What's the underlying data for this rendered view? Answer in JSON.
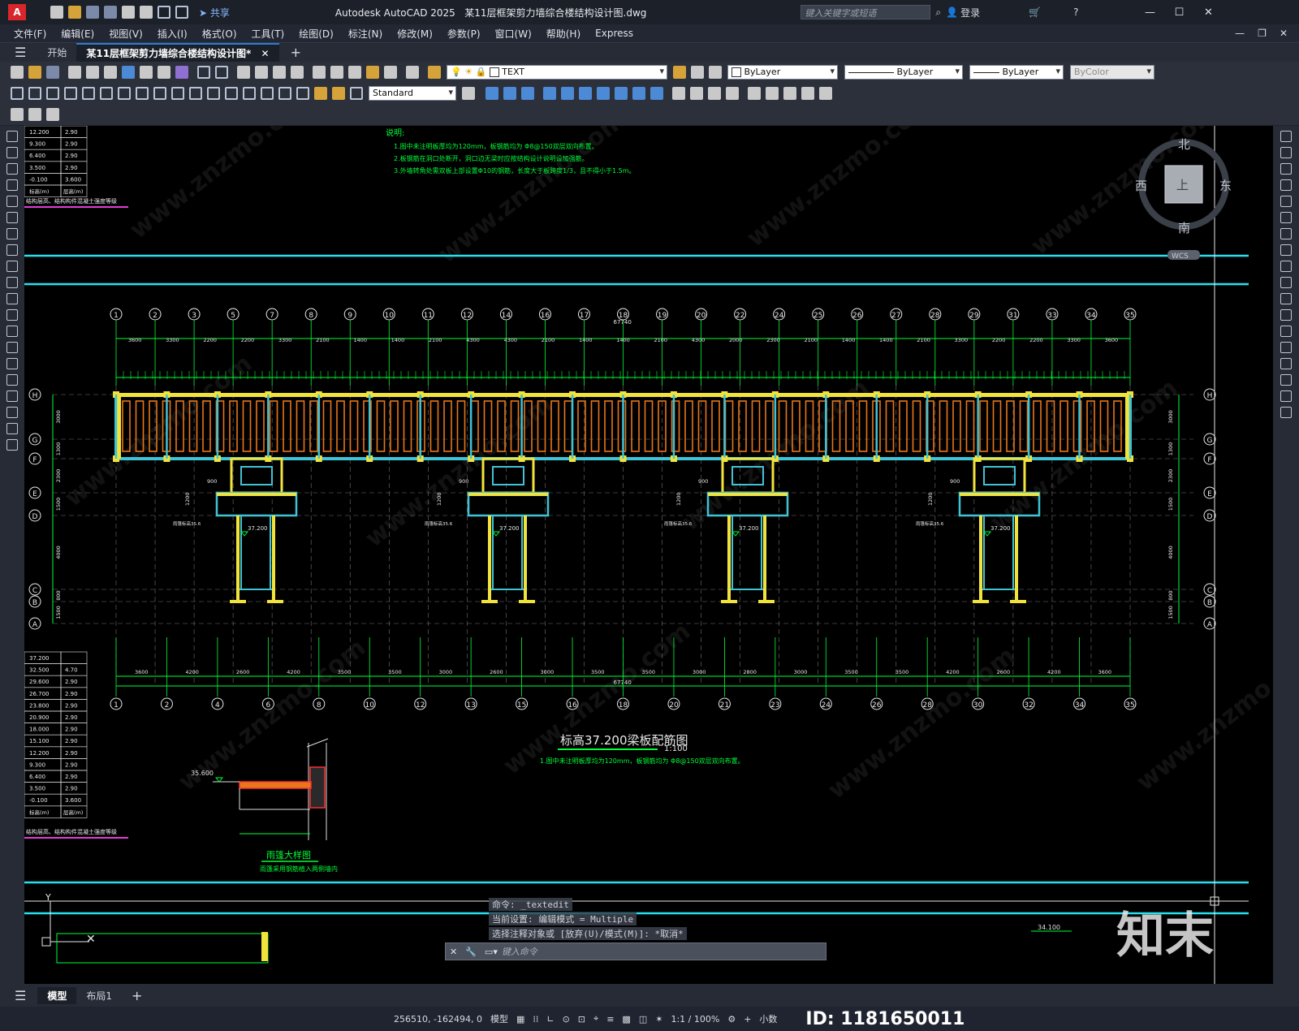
{
  "title_bar": {
    "app_title": "Autodesk AutoCAD 2025",
    "file_name": "某11层框架剪力墙综合楼结构设计图.dwg",
    "share_label": "共享",
    "search_placeholder": "键入关键字或短语",
    "login_label": "登录"
  },
  "menu": {
    "items": [
      "文件(F)",
      "编辑(E)",
      "视图(V)",
      "插入(I)",
      "格式(O)",
      "工具(T)",
      "绘图(D)",
      "标注(N)",
      "修改(M)",
      "参数(P)",
      "窗口(W)",
      "帮助(H)",
      "Express"
    ]
  },
  "tabs": {
    "start": "开始",
    "document": "某11层框架剪力墙综合楼结构设计图*"
  },
  "ribbon": {
    "text_style": "TEXT",
    "layer_color": "ByLayer",
    "linetype": "ByLayer",
    "lineweight": "ByLayer",
    "plot_style": "ByColor",
    "dim_style": "Standard"
  },
  "viewcube": {
    "north": "北",
    "south": "南",
    "east": "东",
    "west": "西",
    "top": "上",
    "wcs": "WCS"
  },
  "drawing": {
    "notes_title": "说明:",
    "notes": [
      "1.图中未注明板厚均为120mm，板钢筋均为 Φ8@150双层双向布置。",
      "2.板钢筋在洞口处断开，洞口边无梁时应按结构设计说明设加强筋。",
      "3.外墙转角处需双板上部设置Φ10的钢筋，长度大于板跨度1/3，且不得小于1.5m。"
    ],
    "plan_title": "标高37.200梁板配筋图",
    "plan_scale": "1:100",
    "plan_note": "1.图中未注明板厚均为120mm，板钢筋均为 Φ8@150双层双向布置。",
    "detail_title": "雨篷大样图",
    "detail_note": "雨篷采用钢筋植入两侧墙内",
    "table_footer": "结构层高、结构构件混凝土强度等级",
    "total_length": "67740",
    "top_elev": "37.200",
    "mid_elev": "34.100",
    "canopy_elev": "35.600",
    "dim_900": "900",
    "dim_1200": "1200",
    "roof_label": "雨篷标高35.6",
    "elevation_label": "37.200",
    "col_h_label": "层高(m)",
    "col_e_label": "标高(m)"
  },
  "axes_top": [
    "1",
    "2",
    "3",
    "5",
    "7",
    "8",
    "9",
    "10",
    "11",
    "12",
    "14",
    "16",
    "17",
    "18",
    "19",
    "20",
    "22",
    "24",
    "25",
    "26",
    "27",
    "28",
    "29",
    "31",
    "33",
    "34",
    "35"
  ],
  "axes_bottom": [
    "1",
    "2",
    "4",
    "6",
    "8",
    "10",
    "12",
    "13",
    "15",
    "16",
    "18",
    "20",
    "21",
    "23",
    "24",
    "26",
    "28",
    "30",
    "32",
    "34",
    "35"
  ],
  "rows": [
    "H",
    "G",
    "F",
    "E",
    "D",
    "C",
    "B",
    "A"
  ],
  "dims_top": [
    "3600",
    "3300",
    "2200",
    "2200",
    "3300",
    "2100",
    "1400",
    "1400",
    "2100",
    "4300",
    "4300",
    "2100",
    "1400",
    "1400",
    "2100",
    "4300",
    "2000",
    "2300",
    "2100",
    "1400",
    "1400",
    "2100",
    "3300",
    "2200",
    "2200",
    "3300",
    "3600"
  ],
  "dims_bottom": [
    "3600",
    "4200",
    "2600",
    "4200",
    "3500",
    "3500",
    "3000",
    "2600",
    "3000",
    "3500",
    "3500",
    "3000",
    "2800",
    "3000",
    "3500",
    "3500",
    "4200",
    "2600",
    "4200",
    "3600"
  ],
  "dims_left": [
    "3000",
    "1300",
    "2300",
    "1500",
    "4000",
    "800",
    "1500"
  ],
  "level_table_top": [
    [
      "12.200",
      "2.90"
    ],
    [
      "9.300",
      "2.90"
    ],
    [
      "6.400",
      "2.90"
    ],
    [
      "3.500",
      "2.90"
    ],
    [
      "-0.100",
      "3.600"
    ]
  ],
  "level_table_bottom": [
    [
      "37.200",
      ""
    ],
    [
      "32.500",
      "4.70"
    ],
    [
      "29.600",
      "2.90"
    ],
    [
      "26.700",
      "2.90"
    ],
    [
      "23.800",
      "2.90"
    ],
    [
      "20.900",
      "2.90"
    ],
    [
      "18.000",
      "2.90"
    ],
    [
      "15.100",
      "2.90"
    ],
    [
      "12.200",
      "2.90"
    ],
    [
      "9.300",
      "2.90"
    ],
    [
      "6.400",
      "2.90"
    ],
    [
      "3.500",
      "2.90"
    ],
    [
      "-0.100",
      "3.600"
    ]
  ],
  "command": {
    "history": [
      "命令: _textedit",
      "当前设置: 编辑模式 = Multiple",
      "选择注释对象或 [放弃(U)/模式(M)]: *取消*"
    ],
    "prompt_placeholder": "键入命令"
  },
  "layout_tabs": {
    "model": "模型",
    "layout1": "布局1"
  },
  "status": {
    "coords": "256510, -162494, 0",
    "model": "模型",
    "scale": "1:1 / 100%",
    "units": "小数"
  },
  "watermark": {
    "site": "www.znzmo.com",
    "brand": "知末",
    "id": "ID: 1181650011"
  },
  "colors": {
    "axis_green": "#00ff3a",
    "wall_cyan": "#3fc3d6",
    "column_yellow": "#f2e33c",
    "hatch_orange": "#e8761a",
    "line_cyan": "#27e0f0",
    "magenta": "#e43cd8"
  }
}
